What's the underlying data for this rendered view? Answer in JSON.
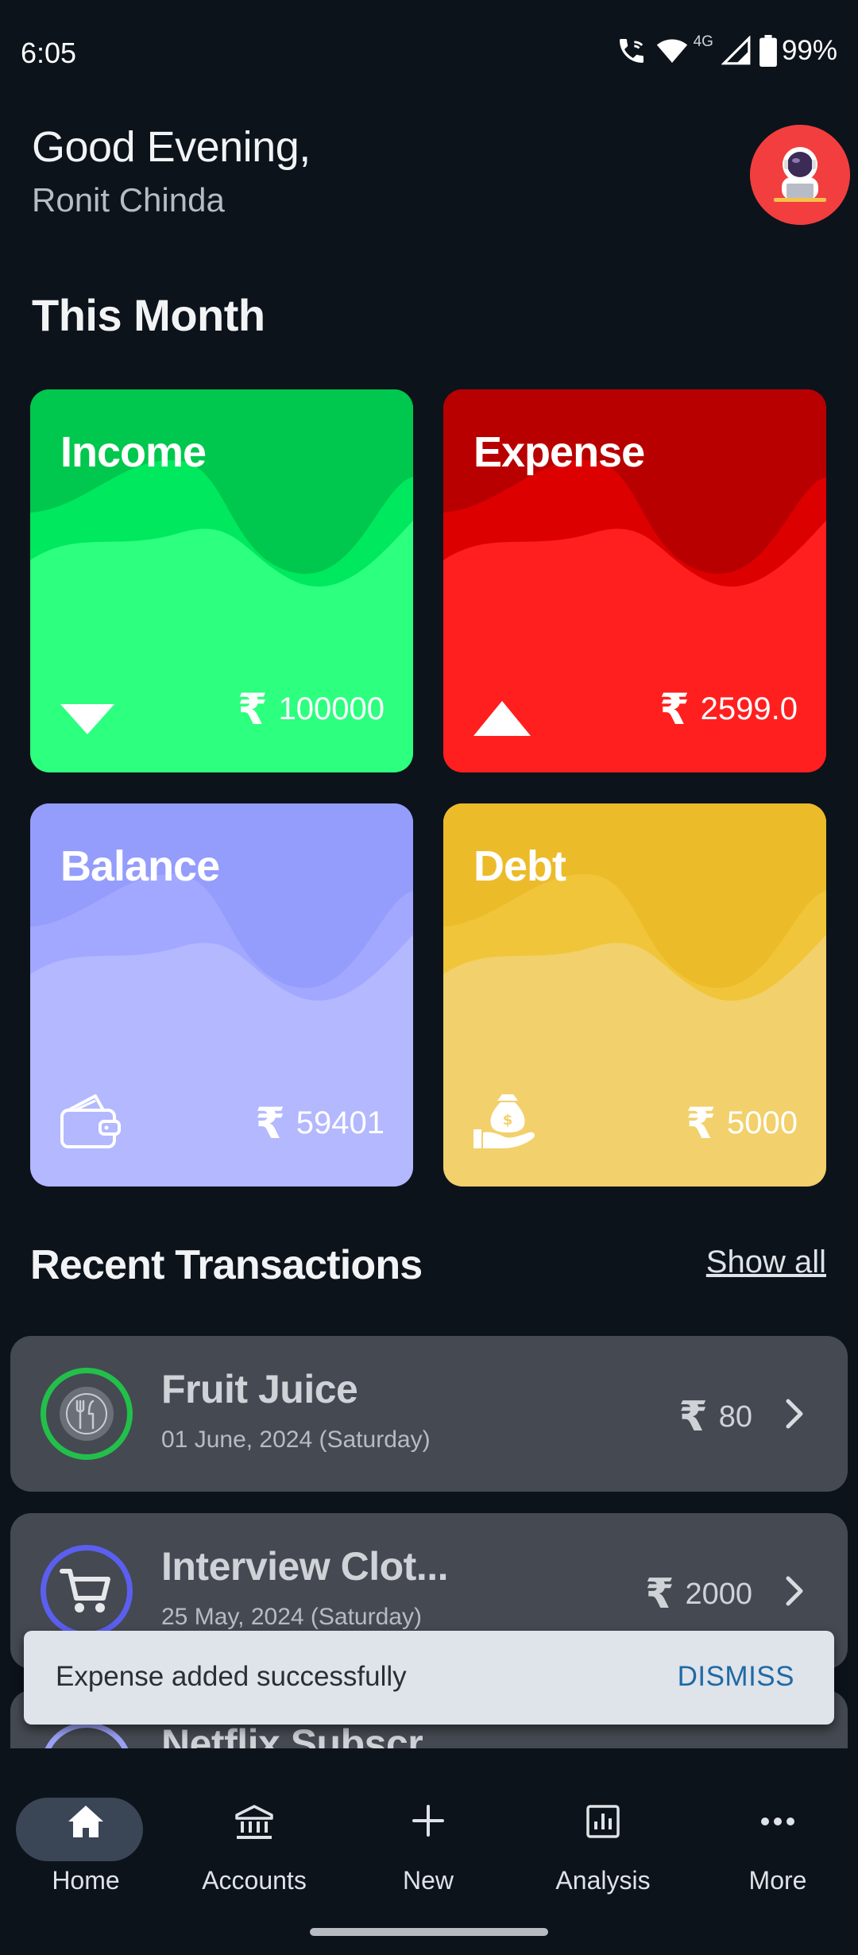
{
  "status_bar": {
    "time": "6:05",
    "network_label": "4G",
    "battery": "99%"
  },
  "header": {
    "greeting": "Good Evening,",
    "user_name": "Ronit Chinda"
  },
  "this_month": {
    "title": "This Month",
    "cards": [
      {
        "label": "Income",
        "currency": "₹",
        "amount": "100000",
        "icon": "arrow-down-icon",
        "color": "#2dff7f"
      },
      {
        "label": "Expense",
        "currency": "₹",
        "amount": "2599.0",
        "icon": "arrow-up-icon",
        "color": "#ff1f1f"
      },
      {
        "label": "Balance",
        "currency": "₹",
        "amount": "59401",
        "icon": "wallet-icon",
        "color": "#b3b8ff"
      },
      {
        "label": "Debt",
        "currency": "₹",
        "amount": "5000",
        "icon": "money-bag-hand-icon",
        "color": "#f2d06b"
      }
    ]
  },
  "recent_transactions": {
    "title": "Recent Transactions",
    "show_all": "Show all",
    "items": [
      {
        "title": "Fruit Juice",
        "date": "01 June, 2024 (Saturday)",
        "currency": "₹",
        "amount": "80",
        "icon": "food-icon",
        "ring_color": "#22c04a"
      },
      {
        "title": "Interview Clot...",
        "date": "25 May, 2024 (Saturday)",
        "currency": "₹",
        "amount": "2000",
        "icon": "shopping-cart-icon",
        "ring_color": "#5b5ff0"
      },
      {
        "title": "Netflix Subscr...",
        "icon": "subscription-icon",
        "ring_color": "#9aa0f5"
      }
    ]
  },
  "snackbar": {
    "message": "Expense added successfully",
    "action": "DISMISS"
  },
  "bottom_nav": {
    "items": [
      {
        "label": "Home",
        "icon": "home-icon",
        "active": true
      },
      {
        "label": "Accounts",
        "icon": "bank-icon",
        "active": false
      },
      {
        "label": "New",
        "icon": "plus-icon",
        "active": false
      },
      {
        "label": "Analysis",
        "icon": "bar-chart-icon",
        "active": false
      },
      {
        "label": "More",
        "icon": "more-dots-icon",
        "active": false
      }
    ]
  }
}
